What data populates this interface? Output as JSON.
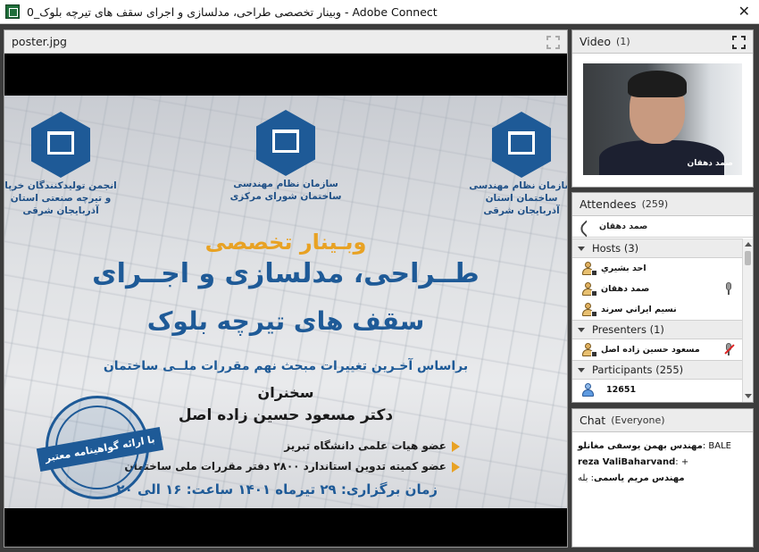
{
  "window": {
    "title": "وبینار تخصصی طراحی، مدلسازی و اجرای سقف های تیرچه بلوک_0 - Adobe Connect",
    "close_glyph": "✕"
  },
  "share_pod": {
    "title": "poster.jpg",
    "poster": {
      "logo_left_caption": "انجمن تولیدکنندگان خرپا و تیرچه صنعتی استان آذربایجان شرقی",
      "logo_center_caption": "سازمان نظام مهندسی ساختمان شورای مرکزی",
      "logo_right_caption": "سازمان نظام مهندسی ساختمان استان آذربایجان شرقی",
      "subtitle": "وبـینار تخصصی",
      "main_line1": "طــراحی، مدلسازی و اجــرای",
      "main_line2": "سقف های تیرچه بلوک",
      "basis": "براساس آخـرین تغییرات مبحث نهم مقررات ملــی ساختمان",
      "speaker_label": "سخنران",
      "speaker_name": "دکتر مسعود حسین زاده اصل",
      "bullets": [
        "عضو هیات علمی دانشگاه تبریز",
        "عضو کمیته تدوین استاندارد ۲۸۰۰ دفتر مقررات ملی ساختمان"
      ],
      "date_line": "زمان برگزاری: ۲۹ تیرماه ۱۴۰۱ ساعت: ۱۶ الی ۲۰",
      "seal_text": "با ارائه گواهینامه معتبر"
    }
  },
  "video_pod": {
    "title": "Video",
    "count": "(1)",
    "presenter_name": "صمد دهقان"
  },
  "attendees_pod": {
    "title": "Attendees",
    "count": "(259)",
    "active_speaker": "صمد دهقان",
    "groups": {
      "hosts": {
        "label": "Hosts (3)",
        "members": [
          "احد بشيري",
          "صمد دهقان",
          "نسيم ايراني سرند"
        ]
      },
      "presenters": {
        "label": "Presenters (1)",
        "members": [
          "مسعود حسين زاده اصل"
        ]
      },
      "participants": {
        "label": "Participants (255)",
        "members": [
          "12651"
        ]
      }
    }
  },
  "chat_pod": {
    "title": "Chat",
    "scope": "(Everyone)",
    "messages": [
      {
        "who": "مهندس بهمن یوسفی مغانلو",
        "text": ": BALE"
      },
      {
        "who": "reza ValiBaharvand",
        "text": ": +"
      },
      {
        "who": "مهندس مریم یاسمی",
        "text": ": بله"
      }
    ]
  },
  "colors": {
    "brand_blue": "#1e5a97",
    "accent_orange": "#e8a224"
  }
}
